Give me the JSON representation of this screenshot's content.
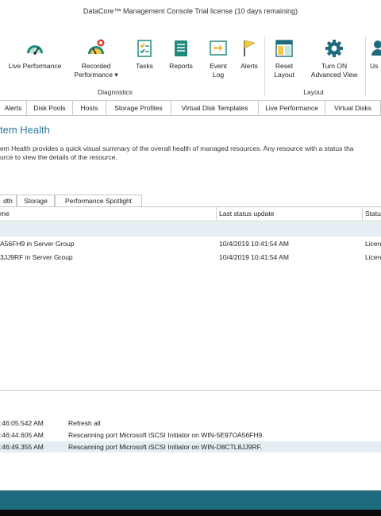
{
  "window": {
    "title": "DataCore™ Management Console    Trial license (10 days remaining)"
  },
  "ribbon": {
    "buttons": [
      {
        "label1": "Live Performance",
        "label2": ""
      },
      {
        "label1": "Recorded",
        "label2": "Performance ▾"
      },
      {
        "label1": "Tasks",
        "label2": ""
      },
      {
        "label1": "Reports",
        "label2": ""
      },
      {
        "label1": "Event",
        "label2": "Log"
      },
      {
        "label1": "Alerts",
        "label2": ""
      },
      {
        "label1": "Reset",
        "label2": "Layout"
      },
      {
        "label1": "Turn ON",
        "label2": "Advanced View"
      },
      {
        "label1": "Us",
        "label2": ""
      }
    ],
    "groups": {
      "diagnostics": "Diagnostics",
      "layout": "Layout"
    }
  },
  "tabs": [
    "Alerts",
    "Disk Pools",
    "Hosts",
    "Storage Profiles",
    "Virtual Disk Templates",
    "Live Performance",
    "Virtual Disks"
  ],
  "page": {
    "heading": "tem Health",
    "desc_line1": "em Health provides a quick visual summary of the overall health of managed resources. Any resource with a status tha",
    "desc_line2": "urce to view the details of the resource."
  },
  "subtabs": [
    "dth",
    "Storage",
    "Performance Spotlight"
  ],
  "grid": {
    "columns": [
      "me",
      "Last status update",
      "Statu"
    ],
    "rows": [
      {
        "name": "A56FH9 in Server Group",
        "updated": "10/4/2019 10:41:54 AM",
        "status": "Licen"
      },
      {
        "name": "3JJ9RF in Server Group",
        "updated": "10/4/2019 10:41:54 AM",
        "status": "Licen"
      }
    ]
  },
  "log": [
    {
      "time": ":46:05.542 AM",
      "message": "Refresh all"
    },
    {
      "time": ":46:44.605 AM",
      "message": "Rescanning port Microsoft iSCSI Initiator on WIN-5E97OA56FH9."
    },
    {
      "time": ":46:49.355 AM",
      "message": "Rescanning port Microsoft iSCSI Initiator on WIN-D8CTL8JJ9RF."
    }
  ],
  "colors": {
    "accent": "#2b7a9b",
    "statusbar": "#1e6b7e",
    "selection": "#e4eef3"
  }
}
